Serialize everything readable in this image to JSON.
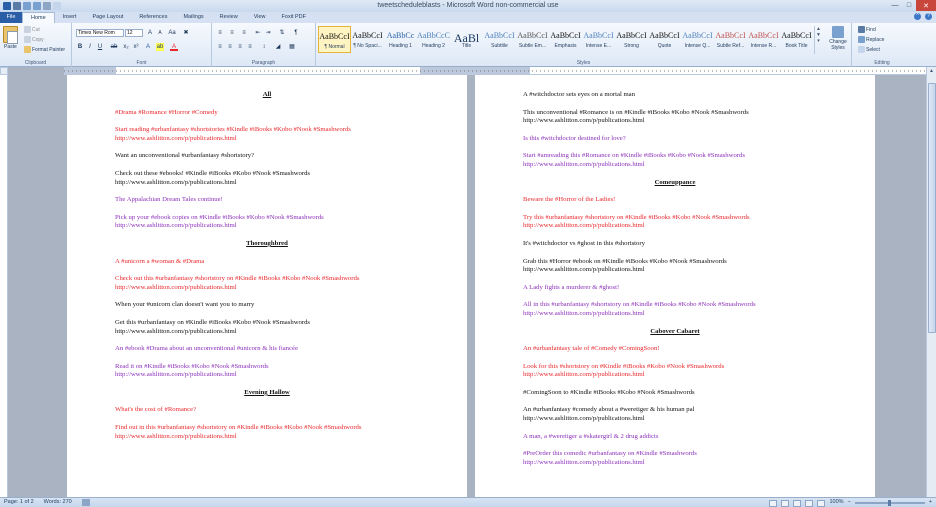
{
  "window": {
    "title": "tweetscheduleblasts - Microsoft Word non-commercial use"
  },
  "tabs": [
    "File",
    "Home",
    "Insert",
    "Page Layout",
    "References",
    "Mailings",
    "Review",
    "View",
    "Foxit PDF"
  ],
  "clipboard": {
    "paste": "Paste",
    "cut": "Cut",
    "copy": "Copy",
    "format_painter": "Format Painter",
    "label": "Clipboard"
  },
  "font": {
    "name": "Times New Rom",
    "size": "12",
    "label": "Font"
  },
  "paragraph": {
    "label": "Paragraph"
  },
  "styles": {
    "items": [
      {
        "sample": "AaBbCcI",
        "name": "¶ Normal"
      },
      {
        "sample": "AaBbCcI",
        "name": "¶ No Spaci..."
      },
      {
        "sample": "AaBbCc",
        "name": "Heading 1"
      },
      {
        "sample": "AaBbCcC",
        "name": "Heading 2"
      },
      {
        "sample": "AaBl",
        "name": "Title"
      },
      {
        "sample": "AaBbCcI",
        "name": "Subtitle"
      },
      {
        "sample": "AaBbCcI",
        "name": "Subtle Em..."
      },
      {
        "sample": "AaBbCcI",
        "name": "Emphasis"
      },
      {
        "sample": "AaBbCcI",
        "name": "Intense E..."
      },
      {
        "sample": "AaBbCcI",
        "name": "Strong"
      },
      {
        "sample": "AaBbCcI",
        "name": "Quote"
      },
      {
        "sample": "AaBbCcI",
        "name": "Intense Q..."
      },
      {
        "sample": "AaBbCcI",
        "name": "Subtle Ref..."
      },
      {
        "sample": "AaBbCcI",
        "name": "Intense R..."
      },
      {
        "sample": "AaBbCcI",
        "name": "Book Title"
      }
    ],
    "change_styles": "Change Styles",
    "label": "Styles"
  },
  "editing": {
    "find": "Find",
    "replace": "Replace",
    "select": "Select",
    "label": "Editing"
  },
  "page1": [
    {
      "type": "heading",
      "text": "All"
    },
    {
      "color": "red",
      "lines": [
        "#Drama #Romance #Horror #Comedy"
      ]
    },
    {
      "color": "red",
      "lines": [
        "Start reading #urbanfantasy #shortstories #Kindle #iBooks #Kobo #Nook #Smashwords",
        "http://www.ashlitton.com/p/publications.html"
      ]
    },
    {
      "color": "black",
      "lines": [
        "Want an unconventional #urbanfantasy #shortstory?"
      ]
    },
    {
      "color": "black",
      "lines": [
        "Check out these #ebooks! #Kindle #iBooks #Kobo #Nook #Smashwords",
        "http://www.ashlitton.com/p/publications.html"
      ]
    },
    {
      "color": "purple",
      "lines": [
        "The Appalachian Dream Tales continue!"
      ]
    },
    {
      "color": "purple",
      "lines": [
        "Pick up your #ebook copies on #Kindle #iBooks #Kobo #Nook #Smashwords",
        "http://www.ashlitton.com/p/publications.html"
      ]
    },
    {
      "type": "heading",
      "text": "Thoroughbred"
    },
    {
      "color": "red",
      "lines": [
        "A #unicorn a #woman & #Drama"
      ]
    },
    {
      "color": "red",
      "lines": [
        "Check out this #urbanfantasy #shortstory on #Kindle #iBooks #Kobo #Nook #Smashwords",
        "http://www.ashlitton.com/p/publications.html"
      ]
    },
    {
      "color": "black",
      "lines": [
        "When your #unicorn clan doesn't want you to marry"
      ]
    },
    {
      "color": "black",
      "lines": [
        "Get this #urbanfantasy on #Kindle #iBooks #Kobo #Nook #Smashwords",
        "http://www.ashlitton.com/p/publications.html"
      ]
    },
    {
      "color": "purple",
      "lines": [
        "An #ebook #Drama about an unconventional #unicorn & his fiancée"
      ]
    },
    {
      "color": "purple",
      "lines": [
        "Read it on #Kindle #iBooks #Kobo #Nook #Smashwords",
        "http://www.ashlitton.com/p/publications.html"
      ]
    },
    {
      "type": "heading",
      "text": "Evening Hallow"
    },
    {
      "color": "red",
      "lines": [
        "What's the cost of #Romance?"
      ]
    },
    {
      "color": "red",
      "lines": [
        "Find out in this #urbanfantasy #shortstory on #Kindle #iBooks #Kobo #Nook #Smashwords",
        "http://www.ashlitton.com/p/publications.html"
      ]
    }
  ],
  "page2": [
    {
      "color": "black",
      "lines": [
        "A #witchdoctor sets eyes on a mortal man"
      ]
    },
    {
      "color": "black",
      "lines": [
        "This unconventional #Romance is on #Kindle #iBooks #Kobo #Nook #Smashwords",
        "http://www.ashlitton.com/p/publications.html"
      ]
    },
    {
      "color": "purple",
      "lines": [
        "Is this #witchdoctor destined for love?"
      ]
    },
    {
      "color": "purple",
      "lines": [
        "Start #amreading this #Romance on #Kindle #iBooks #Kobo #Nook #Smashwords",
        "http://www.ashlitton.com/p/publications.html"
      ]
    },
    {
      "type": "heading",
      "text": "Comeuppance"
    },
    {
      "color": "red",
      "lines": [
        "Beware the #Horror of the Ladies!"
      ]
    },
    {
      "color": "red",
      "lines": [
        "Try this #urbanfantasy #shortstory on #Kindle #iBooks #Kobo #Nook #Smashwords",
        "http://www.ashlitton.com/p/publications.html"
      ]
    },
    {
      "color": "black",
      "lines": [
        "It's #witchdoctor vs #ghost in this #shortstory"
      ]
    },
    {
      "color": "black",
      "lines": [
        "Grab this #Horror #ebook on #Kindle #iBooks #Kobo #Nook #Smashwords",
        "http://www.ashlitton.com/p/publications.html"
      ]
    },
    {
      "color": "purple",
      "lines": [
        "A Lady fights a murderer & #ghost!"
      ]
    },
    {
      "color": "purple",
      "lines": [
        "All in this #urbanfantasy #shortstory on #Kindle #iBooks #Kobo #Nook #Smashwords",
        "http://www.ashlitton.com/p/publications.html"
      ]
    },
    {
      "type": "heading",
      "text": "Cabover Cabaret"
    },
    {
      "color": "red",
      "lines": [
        "An #urbanfantasy tale of #Comedy #ComingSoon!"
      ]
    },
    {
      "color": "red",
      "lines": [
        "Look for this #shortstory on #Kindle #iBooks #Kobo #Nook #Smashwords",
        "http://www.ashlitton.com/p/publications.html"
      ]
    },
    {
      "color": "black",
      "lines": [
        "#ComingSoon to #Kindle #iBooks #Kobo #Nook #Smashwords"
      ]
    },
    {
      "color": "black",
      "lines": [
        "An #urbanfantasy #comedy about a #weretiger & his human pal",
        "http://www.ashlitton.com/p/publications.html"
      ]
    },
    {
      "color": "purple",
      "lines": [
        "A man, a #weretiger a #skatergirl & 2 drug addicts"
      ]
    },
    {
      "color": "purple",
      "lines": [
        "#PreOrder this comedic #urbanfantasy on #Kindle #Smashwords",
        "http://www.ashlitton.com/p/publications.html"
      ]
    }
  ],
  "status": {
    "page": "Page: 1 of 2",
    "words": "Words: 270",
    "zoom": "100%"
  },
  "colors": {
    "red": "#e8262b",
    "purple": "#8b2fb8",
    "file_tab": "#2a5fa8"
  }
}
